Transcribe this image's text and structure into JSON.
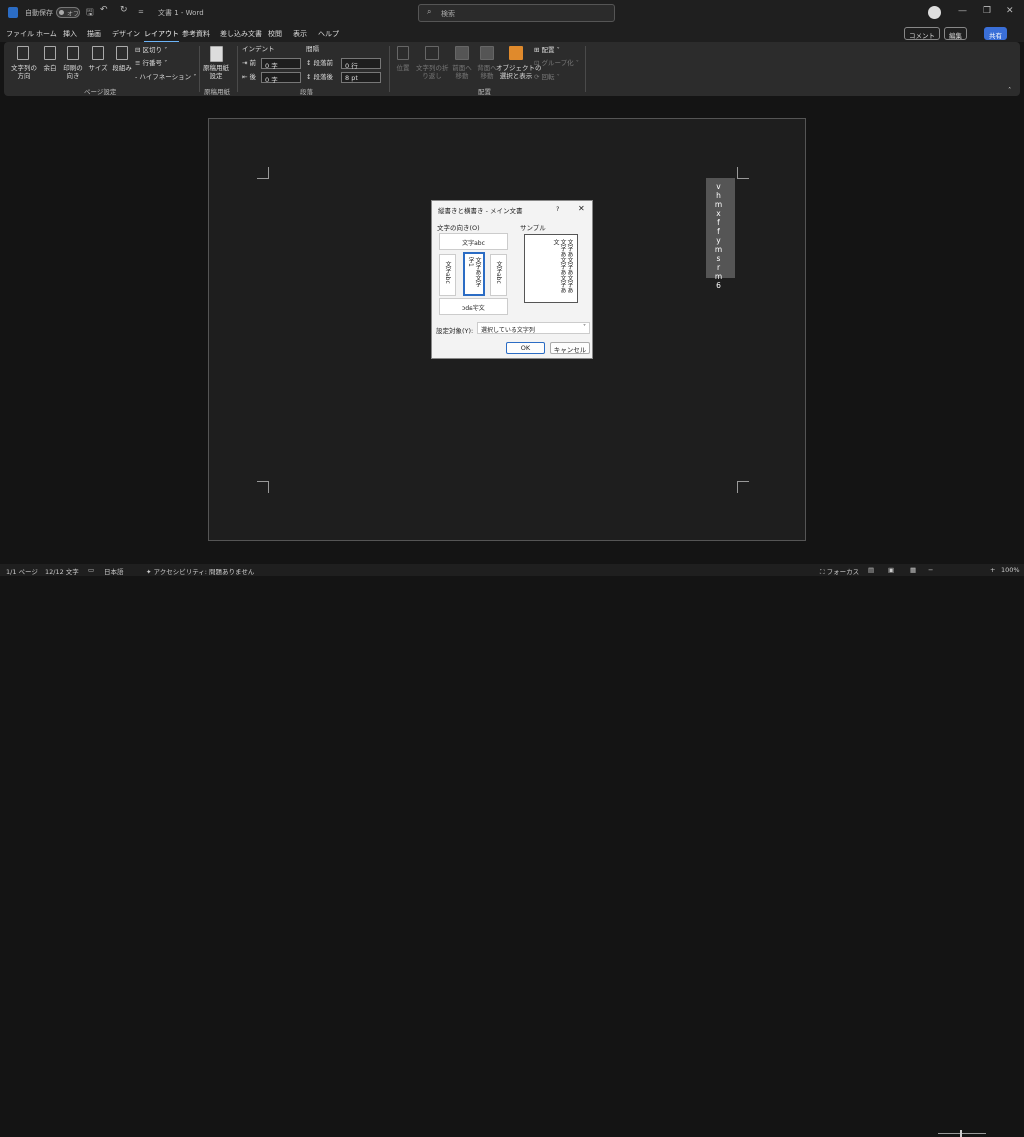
{
  "titlebar": {
    "autosave_label": "自動保存",
    "autosave_state": "オフ",
    "doc_title": "文書 1  -  Word",
    "search_placeholder": "検索",
    "minimize": "—",
    "restore": "❐",
    "close": "✕"
  },
  "menu": {
    "items": [
      "ファイル",
      "ホーム",
      "挿入",
      "描画",
      "デザイン",
      "レイアウト",
      "参考資料",
      "差し込み文書",
      "校閲",
      "表示",
      "ヘルプ"
    ],
    "comment": "コメント",
    "edit": "編集",
    "share": "共有"
  },
  "ribbon": {
    "text_direction": "文字列の\n方向",
    "margins": "余白",
    "orientation": "印刷の\n向き",
    "size": "サイズ",
    "columns": "段組み",
    "breaks": "区切り",
    "line_numbers": "行番号",
    "hyphenation": "ハイフネーション",
    "group_page_setup": "ページ設定",
    "manuscript": "原稿用紙\n設定",
    "group_manuscript": "原稿用紙",
    "indent_label": "インデント",
    "spacing_label": "間隔",
    "indent_before_label": "前",
    "indent_before_value": "0 字",
    "indent_after_label": "後",
    "indent_after_value": "0 字",
    "space_before_label": "段落前",
    "space_before_value": "0 行",
    "space_after_label": "段落後",
    "space_after_value": "8 pt",
    "group_paragraph": "段落",
    "position": "位置",
    "wrap": "文字列の折\nり返し",
    "forward": "前面へ\n移動",
    "backward": "背面へ\n移動",
    "selection_pane": "オブジェクトの\n選択と表示",
    "align": "配置",
    "group": "グループ化",
    "rotate": "回転",
    "group_arrange": "配置"
  },
  "document": {
    "vertical_text": "vhmxffymsrm6"
  },
  "dialog": {
    "title": "縦書きと横書き - メイン文書",
    "help": "?",
    "close": "✕",
    "direction_label": "文字の向き(O)",
    "sample_label": "サンプル",
    "opt_horizontal": "文字abc",
    "opt_vertical_left": "文字abc",
    "opt_vertical_selected": "文字あ文字\n字1",
    "opt_vertical_right": "文字abc",
    "opt_horizontal_flip": "文字abc",
    "sample_text": "文字あ文字あ文字あ文字あ文字あ文字あ文",
    "apply_to_label": "設定対象(Y):",
    "apply_to_value": "選択している文字列",
    "ok": "OK",
    "cancel": "キャンセル"
  },
  "status": {
    "page": "1/1 ページ",
    "words": "12/12 文字",
    "language": "日本語",
    "accessibility": "アクセシビリティ: 問題ありません",
    "focus": "フォーカス",
    "zoom": "100%"
  }
}
